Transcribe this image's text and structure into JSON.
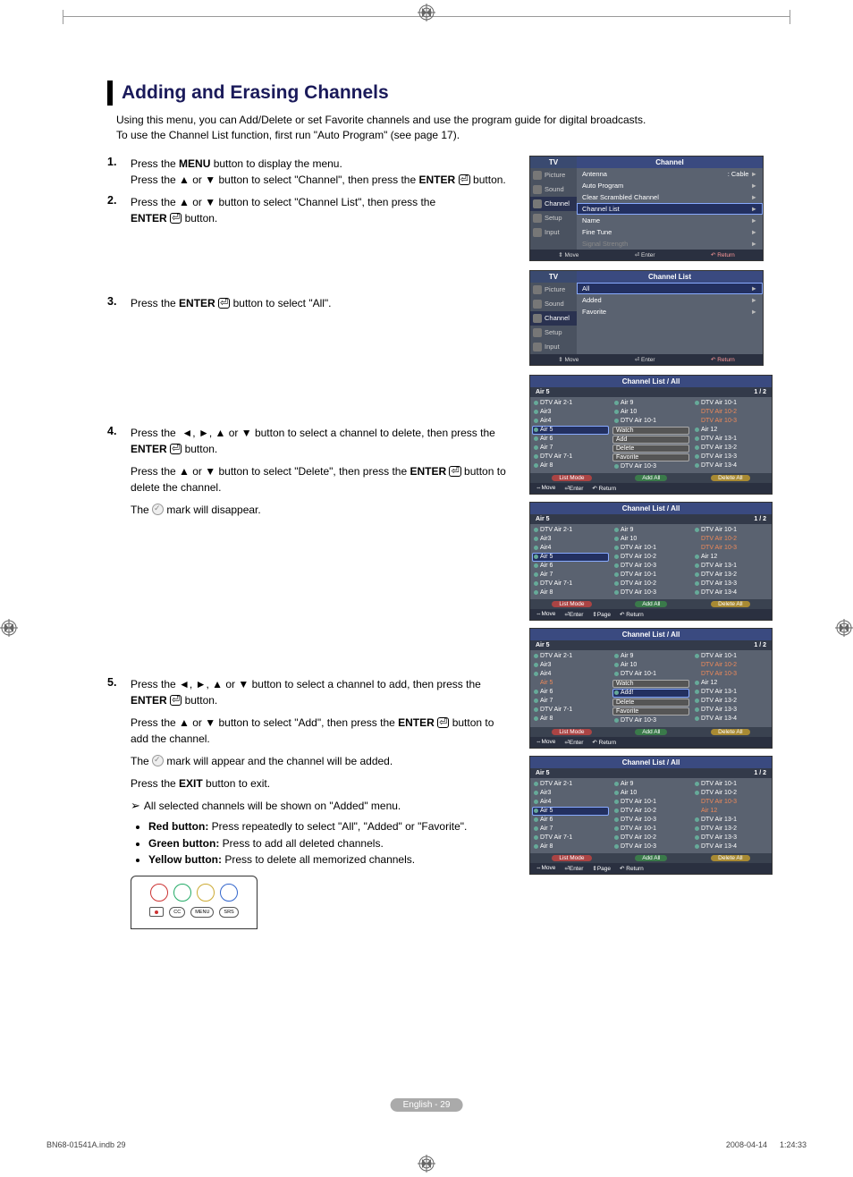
{
  "page": {
    "title": "Adding and Erasing Channels",
    "intro": "Using this menu, you can Add/Delete or set Favorite channels and use the program guide for digital broadcasts.\nTo use the Channel List function, first run \"Auto Program\" (see page 17).",
    "footer_pill": "English - 29",
    "footer_left": "BN68-01541A.indb   29",
    "footer_right": "2008-04-14      1:24:33"
  },
  "glyphs": {
    "up": "▲",
    "down": "▼",
    "left": "◄",
    "right": "►",
    "enter": "⏎",
    "note": "➢",
    "return": "↶",
    "tri": "►"
  },
  "steps": {
    "s1a": "Press the ",
    "s1b": " button to display the menu.",
    "s1c_a": "Press the ",
    "s1c_b": " or ",
    "s1c_c": " button to select \"Channel\", then press the ",
    "s1c_d": " button.",
    "menu": "MENU",
    "enter": "ENTER",
    "s2a": "Press the ",
    "s2b": " or ",
    "s2c": " button to select \"Channel List\", then press the ",
    "s2d": " button.",
    "s3a": "Press the ",
    "s3b": " button to select \"All\".",
    "s4a": "Press the ",
    "s4b": ", ",
    "s4c": ", ",
    "s4d": " or ",
    "s4e": " button to select a channel to delete, then press the ",
    "s4f": " button.",
    "s4g_a": "Press the ",
    "s4g_b": " or ",
    "s4g_c": " button to select \"Delete\", then press the ",
    "s4g_d": " button to delete the channel.",
    "s4h": "The ",
    "s4i": " mark will disappear.",
    "s5a": "Press the ",
    "s5b": ", ",
    "s5c": ", ",
    "s5d": " or ",
    "s5e": " button to select a channel to add, then press the ",
    "s5f": " button.",
    "s5g_a": "Press the ",
    "s5g_b": " or ",
    "s5g_c": " button to select \"Add\", then press the ",
    "s5g_d": " button to add the channel.",
    "s5h": "The ",
    "s5i": " mark will appear and the channel will be added.",
    "s5j_a": "Press the ",
    "s5j_b": " button to exit.",
    "exit": "EXIT",
    "note_all": "All selected channels will be shown on \"Added\" menu.",
    "red_b": "Red button:",
    "red_t": " Press repeatedly to select \"All\", \"Added\" or \"Favorite\".",
    "green_b": "Green button:",
    "green_t": " Press to add all deleted channels.",
    "yellow_b": "Yellow button:",
    "yellow_t": " Press to delete all memorized channels."
  },
  "osd1": {
    "tv": "TV",
    "title": "Channel",
    "side": [
      "Picture",
      "Sound",
      "Channel",
      "Setup",
      "Input"
    ],
    "rows": [
      {
        "l": "Antenna",
        "r": ": Cable"
      },
      {
        "l": "Auto Program",
        "r": ""
      },
      {
        "l": "Clear Scrambled Channel",
        "r": ""
      },
      {
        "l": "Channel List",
        "r": "",
        "hl": true
      },
      {
        "l": "Name",
        "r": ""
      },
      {
        "l": "Fine Tune",
        "r": ""
      },
      {
        "l": "Signal Strength",
        "r": "",
        "dim": true
      }
    ],
    "bar": {
      "a": "Move",
      "b": "Enter",
      "c": "Return"
    }
  },
  "osd2": {
    "tv": "TV",
    "title": "Channel List",
    "side": [
      "Picture",
      "Sound",
      "Channel",
      "Setup",
      "Input"
    ],
    "rows": [
      {
        "l": "All",
        "r": "",
        "hl": true
      },
      {
        "l": "Added",
        "r": ""
      },
      {
        "l": "Favorite",
        "r": ""
      }
    ],
    "bar": {
      "a": "Move",
      "b": "Enter",
      "c": "Return"
    }
  },
  "cl_screens": [
    {
      "title": "Channel List / All",
      "sub": "Air 5",
      "page": "1 / 2",
      "cols": [
        [
          "DTV Air 2-1",
          "Air3",
          "Air4",
          "Air 5*",
          "Air 6",
          "Air 7",
          "DTV Air 7-1",
          "Air 8"
        ],
        [
          "Air 9",
          "Air 10",
          "DTV Air 10-1",
          "Watch!",
          "Add!",
          "Delete!",
          "Favorite!",
          "DTV Air 10-3"
        ],
        [
          "DTV Air 10-1",
          "DTV Air 10-2~",
          "DTV Air 10-3~",
          "Air 12",
          "DTV Air 13-1",
          "DTV Air 13-2",
          "DTV Air 13-3",
          "DTV Air 13-4"
        ]
      ],
      "buttons": [
        "List Mode",
        "Add All",
        "Delete All"
      ],
      "bar": [
        "Move",
        "Enter",
        "",
        "Return"
      ]
    },
    {
      "title": "Channel List / All",
      "sub": "Air 5",
      "page": "1 / 2",
      "cols": [
        [
          "DTV Air 2-1",
          "Air3",
          "Air4",
          "Air 5*",
          "Air 6",
          "Air 7",
          "DTV Air 7-1",
          "Air 8"
        ],
        [
          "Air 9",
          "Air 10",
          "DTV Air 10-1",
          "DTV Air 10-2",
          "DTV Air 10-3",
          "DTV Air 10-1",
          "DTV Air 10-2",
          "DTV Air 10-3"
        ],
        [
          "DTV Air 10-1",
          "DTV Air 10-2~",
          "DTV Air 10-3~",
          "Air 12",
          "DTV Air 13-1",
          "DTV Air 13-2",
          "DTV Air 13-3",
          "DTV Air 13-4"
        ]
      ],
      "buttons": [
        "List Mode",
        "Add All",
        "Delete All"
      ],
      "bar": [
        "Move",
        "Enter",
        "Page",
        "Return"
      ]
    },
    {
      "title": "Channel List / All",
      "sub": "Air 5",
      "page": "1 / 2",
      "cols": [
        [
          "DTV Air 2-1",
          "Air3",
          "Air4",
          "Air 5~",
          "Air 6",
          "Air 7",
          "DTV Air 7-1",
          "Air 8"
        ],
        [
          "Air 9",
          "Air 10",
          "DTV Air 10-1",
          "Watch!",
          "Add!*",
          "Delete!",
          "Favorite!",
          "DTV Air 10-3"
        ],
        [
          "DTV Air 10-1",
          "DTV Air 10-2~",
          "DTV Air 10-3~",
          "Air 12",
          "DTV Air 13-1",
          "DTV Air 13-2",
          "DTV Air 13-3",
          "DTV Air 13-4"
        ]
      ],
      "buttons": [
        "List Mode",
        "Add All",
        "Delete All"
      ],
      "bar": [
        "Move",
        "Enter",
        "",
        "Return"
      ]
    },
    {
      "title": "Channel List / All",
      "sub": "Air 5",
      "page": "1 / 2",
      "cols": [
        [
          "DTV Air 2-1",
          "Air3",
          "Air4",
          "Air 5*",
          "Air 6",
          "Air 7",
          "DTV Air 7-1",
          "Air 8"
        ],
        [
          "Air 9",
          "Air 10",
          "DTV Air 10-1",
          "DTV Air 10-2",
          "DTV Air 10-3",
          "DTV Air 10-1",
          "DTV Air 10-2",
          "DTV Air 10-3"
        ],
        [
          "DTV Air 10-1",
          "DTV Air 10-2",
          "DTV Air 10-3~",
          "Air 12~",
          "DTV Air 13-1",
          "DTV Air 13-2",
          "DTV Air 13-3",
          "DTV Air 13-4"
        ]
      ],
      "buttons": [
        "List Mode",
        "Add All",
        "Delete All"
      ],
      "bar": [
        "Move",
        "Enter",
        "Page",
        "Return"
      ]
    }
  ],
  "remote": {
    "labels": [
      "CC",
      "MENU",
      "SRS"
    ]
  }
}
